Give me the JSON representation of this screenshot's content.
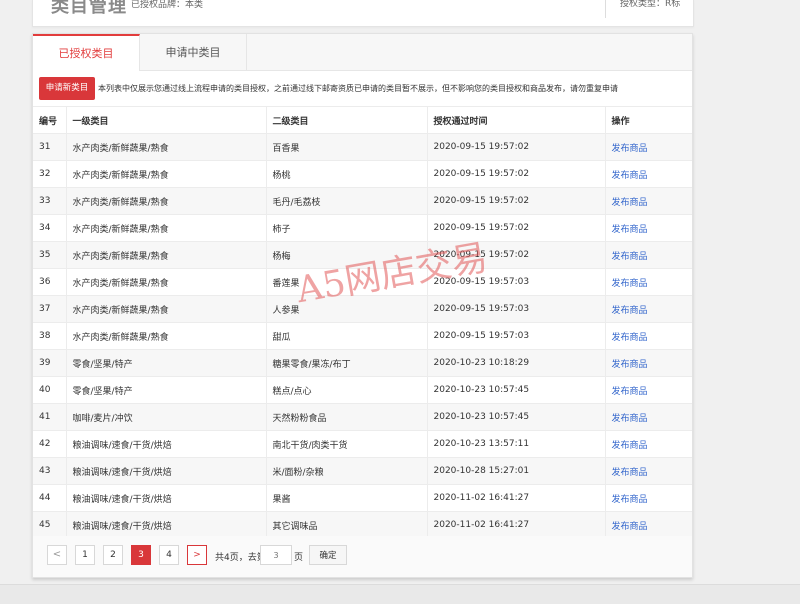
{
  "header": {
    "title": "类目管理",
    "status_text": "已授权品牌：本类",
    "auth_type": "授权类型：R标"
  },
  "tabs": [
    {
      "label": "已授权类目",
      "active": true
    },
    {
      "label": "申请中类目",
      "active": false
    }
  ],
  "notice": {
    "apply_button": "申请新类目",
    "text": "本列表中仅展示您通过线上流程申请的类目授权，之前通过线下邮寄资质已申请的类目暂不展示，但不影响您的类目授权和商品发布，请勿重复申请"
  },
  "table": {
    "columns": [
      "编号",
      "一级类目",
      "二级类目",
      "授权通过时间",
      "操作"
    ],
    "action_label": "发布商品",
    "rows": [
      {
        "id": "31",
        "cat1": "水产肉类/新鲜蔬果/熟食",
        "cat2": "百香果",
        "time": "2020-09-15 19:57:02"
      },
      {
        "id": "32",
        "cat1": "水产肉类/新鲜蔬果/熟食",
        "cat2": "杨桃",
        "time": "2020-09-15 19:57:02"
      },
      {
        "id": "33",
        "cat1": "水产肉类/新鲜蔬果/熟食",
        "cat2": "毛丹/毛荔枝",
        "time": "2020-09-15 19:57:02"
      },
      {
        "id": "34",
        "cat1": "水产肉类/新鲜蔬果/熟食",
        "cat2": "柿子",
        "time": "2020-09-15 19:57:02"
      },
      {
        "id": "35",
        "cat1": "水产肉类/新鲜蔬果/熟食",
        "cat2": "杨梅",
        "time": "2020-09-15 19:57:02"
      },
      {
        "id": "36",
        "cat1": "水产肉类/新鲜蔬果/熟食",
        "cat2": "番莲果",
        "time": "2020-09-15 19:57:03"
      },
      {
        "id": "37",
        "cat1": "水产肉类/新鲜蔬果/熟食",
        "cat2": "人参果",
        "time": "2020-09-15 19:57:03"
      },
      {
        "id": "38",
        "cat1": "水产肉类/新鲜蔬果/熟食",
        "cat2": "甜瓜",
        "time": "2020-09-15 19:57:03"
      },
      {
        "id": "39",
        "cat1": "零食/坚果/特产",
        "cat2": "糖果零食/果冻/布丁",
        "time": "2020-10-23 10:18:29"
      },
      {
        "id": "40",
        "cat1": "零食/坚果/特产",
        "cat2": "糕点/点心",
        "time": "2020-10-23 10:57:45"
      },
      {
        "id": "41",
        "cat1": "咖啡/麦片/冲饮",
        "cat2": "天然粉粉食品",
        "time": "2020-10-23 10:57:45"
      },
      {
        "id": "42",
        "cat1": "粮油调味/速食/干货/烘焙",
        "cat2": "南北干货/肉类干货",
        "time": "2020-10-23 13:57:11"
      },
      {
        "id": "43",
        "cat1": "粮油调味/速食/干货/烘焙",
        "cat2": "米/面粉/杂粮",
        "time": "2020-10-28 15:27:01"
      },
      {
        "id": "44",
        "cat1": "粮油调味/速食/干货/烘焙",
        "cat2": "果酱",
        "time": "2020-11-02 16:41:27"
      },
      {
        "id": "45",
        "cat1": "粮油调味/速食/干货/烘焙",
        "cat2": "其它调味品",
        "time": "2020-11-02 16:41:27"
      }
    ]
  },
  "pagination": {
    "prev": "<",
    "pages": [
      "1",
      "2",
      "3",
      "4"
    ],
    "current": "3",
    "next": ">",
    "total_text": "共4页，去第",
    "input_placeholder": "3",
    "unit": "页",
    "confirm_label": "确定"
  },
  "watermark": "A5网店交易",
  "colors": {
    "accent": "#d9373a",
    "link": "#3366cc"
  }
}
